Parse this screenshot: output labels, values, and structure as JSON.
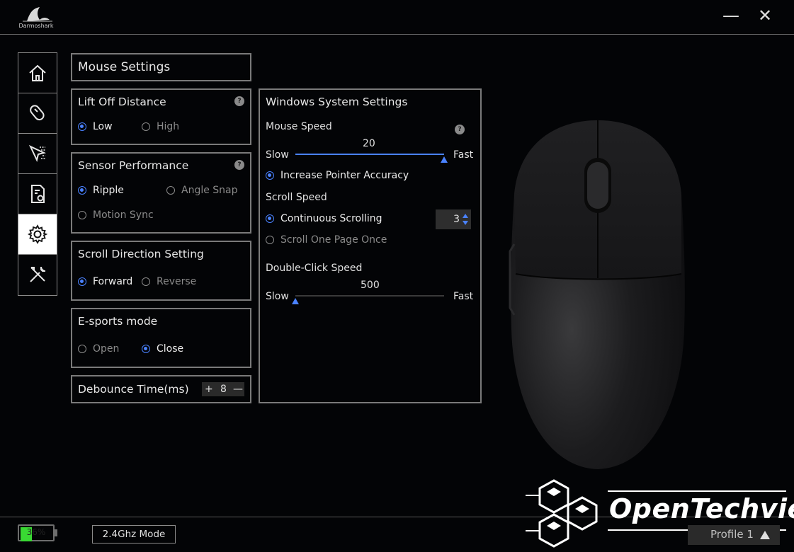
{
  "app": {
    "brand": "Darmoshark",
    "minimize_glyph": "—",
    "close_glyph": "✕"
  },
  "sidebar": {
    "items": [
      {
        "icon": "home-icon",
        "active": false
      },
      {
        "icon": "mouse-icon",
        "active": false
      },
      {
        "icon": "cursor-macro-icon",
        "active": false
      },
      {
        "icon": "document-settings-icon",
        "active": false
      },
      {
        "icon": "gear-icon",
        "active": true
      },
      {
        "icon": "tools-icon",
        "active": false
      }
    ]
  },
  "mouse_settings": {
    "header": "Mouse Settings",
    "lift_off": {
      "title": "Lift Off Distance",
      "help": "?",
      "options": [
        "Low",
        "High"
      ],
      "selected": "Low"
    },
    "sensor": {
      "title": "Sensor Performance",
      "help": "?",
      "options": [
        "Ripple",
        "Angle Snap",
        "Motion Sync"
      ],
      "selected": "Ripple"
    },
    "scroll_direction": {
      "title": "Scroll Direction Setting",
      "options": [
        "Forward",
        "Reverse"
      ],
      "selected": "Forward"
    },
    "esports": {
      "title": "E-sports mode",
      "options": [
        "Open",
        "Close"
      ],
      "selected": "Close"
    },
    "debounce": {
      "title": "Debounce Time(ms)",
      "plus": "+",
      "value": "8",
      "minus": "—"
    }
  },
  "windows_settings": {
    "title": "Windows System Settings",
    "mouse_speed": {
      "label": "Mouse Speed",
      "help": "?",
      "value": "20",
      "fraction": 1.0,
      "min_label": "Slow",
      "max_label": "Fast"
    },
    "pointer_accuracy": {
      "label": "Increase Pointer Accuracy",
      "checked": true
    },
    "scroll_speed": {
      "label": "Scroll Speed",
      "options": [
        "Continuous Scrolling",
        "Scroll One Page Once"
      ],
      "selected": "Continuous Scrolling",
      "lines": "3"
    },
    "double_click": {
      "label": "Double-Click Speed",
      "value": "500",
      "fraction": 0.0,
      "min_label": "Slow",
      "max_label": "Fast"
    }
  },
  "footer": {
    "battery": "36%",
    "battery_fraction": 0.36,
    "connection_mode": "2.4Ghz Mode",
    "profile": "Profile 1",
    "watermark": "OpenTechview"
  },
  "colors": {
    "accent": "#4a82ff",
    "battery": "#39d933",
    "background": "#030406",
    "panel_border": "#7a7a7a"
  }
}
